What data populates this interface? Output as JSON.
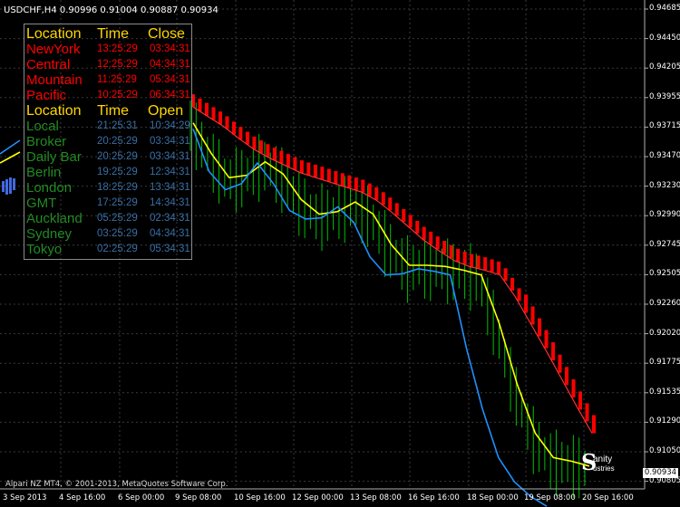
{
  "chart_header": {
    "symbol": "USDCHF,H4",
    "ohlc": "0.90996 0.91004 0.90887 0.90934"
  },
  "copyright": "Alpari NZ MT4, © 2001-2013, MetaQuotes Software Corp.",
  "current_price": "0.90934",
  "logo": {
    "mark": "S",
    "line1": "anity",
    "line2": "ustries"
  },
  "sessions_panel": {
    "close_header": {
      "col1": "Location",
      "col2": "Time",
      "col3": "Close"
    },
    "close_rows": [
      {
        "name": "NewYork",
        "time": "13:25:29",
        "countdown": "03:34:31",
        "color": "#ff0000"
      },
      {
        "name": "Central",
        "time": "12:25:29",
        "countdown": "04:34:31",
        "color": "#ff0000"
      },
      {
        "name": "Mountain",
        "time": "11:25:29",
        "countdown": "05:34:31",
        "color": "#ff0000"
      },
      {
        "name": "Pacific",
        "time": "10:25:29",
        "countdown": "06:34:31",
        "color": "#ff0000"
      }
    ],
    "open_header": {
      "col1": "Location",
      "col2": "Time",
      "col3": "Open"
    },
    "open_rows": [
      {
        "name": "Local",
        "time": "21:25:31",
        "countdown": "10:34:29",
        "color": "#228b22"
      },
      {
        "name": "Broker",
        "time": "20:25:29",
        "countdown": "03:34:31",
        "color": "#228b22"
      },
      {
        "name": "Daily Bar",
        "time": "20:25:29",
        "countdown": "03:34:31",
        "color": "#228b22"
      },
      {
        "name": "Berlin",
        "time": "19:25:29",
        "countdown": "12:34:31",
        "color": "#228b22"
      },
      {
        "name": "London",
        "time": "18:25:29",
        "countdown": "13:34:31",
        "color": "#228b22"
      },
      {
        "name": "GMT",
        "time": "17:25:29",
        "countdown": "14:34:31",
        "color": "#228b22"
      },
      {
        "name": "Auckland",
        "time": "05:25:29",
        "countdown": "02:34:31",
        "color": "#228b22"
      },
      {
        "name": "Sydney",
        "time": "03:25:29",
        "countdown": "04:34:31",
        "color": "#228b22"
      },
      {
        "name": "Tokyo",
        "time": "02:25:29",
        "countdown": "05:34:31",
        "color": "#228b22"
      }
    ],
    "header_color": "#ffd700",
    "time_color_close": "#ff0000",
    "time_color_open": "#3a6ea5"
  },
  "chart_data": {
    "type": "line",
    "title": "",
    "y_axis_labels": [
      "0.94685",
      "0.94450",
      "0.94205",
      "0.93955",
      "0.93715",
      "0.93470",
      "0.93230",
      "0.92990",
      "0.92745",
      "0.92505",
      "0.92260",
      "0.92020",
      "0.91775",
      "0.91535",
      "0.91290",
      "0.91050",
      "0.90805"
    ],
    "x_axis_labels": [
      "3 Sep 2013",
      "4 Sep 16:00",
      "6 Sep 00:00",
      "9 Sep 08:00",
      "10 Sep 16:00",
      "12 Sep 00:00",
      "13 Sep 08:00",
      "16 Sep 16:00",
      "18 Sep 00:00",
      "19 Sep 08:00",
      "20 Sep 16:00"
    ],
    "ylim": [
      0.907,
      0.947
    ],
    "grid": true,
    "colors": {
      "bar": "#00c000",
      "red_line": "#ff3030",
      "red_marks": "#ff0000",
      "yellow_line": "#ffff00",
      "blue_line": "#1e90ff",
      "grid": "#3a3a3a"
    },
    "series": [
      {
        "values": [
          0.9388,
          0.938,
          0.9372,
          0.9362,
          0.9353,
          0.9346,
          0.934,
          0.9334,
          0.933,
          0.9326,
          0.9322,
          0.9318,
          0.9311,
          0.9301,
          0.929,
          0.9279,
          0.927,
          0.9262,
          0.9257,
          0.9254,
          0.925,
          0.9232,
          0.921,
          0.9188,
          0.9165,
          0.9142,
          0.912
        ]
      },
      {
        "values": [
          0.9375,
          0.935,
          0.933,
          0.9332,
          0.9343,
          0.9333,
          0.9312,
          0.93,
          0.9302,
          0.931,
          0.93,
          0.9275,
          0.9258,
          0.9258,
          0.9257,
          0.9254,
          0.925,
          0.921,
          0.916,
          0.912,
          0.91,
          0.9097,
          0.9093
        ]
      },
      {
        "values": [
          0.937,
          0.9335,
          0.932,
          0.9325,
          0.9342,
          0.9325,
          0.9303,
          0.9296,
          0.9297,
          0.9306,
          0.9293,
          0.9265,
          0.925,
          0.9251,
          0.9255,
          0.9253,
          0.925,
          0.919,
          0.914,
          0.91,
          0.908,
          0.9068,
          0.906
        ]
      }
    ]
  }
}
